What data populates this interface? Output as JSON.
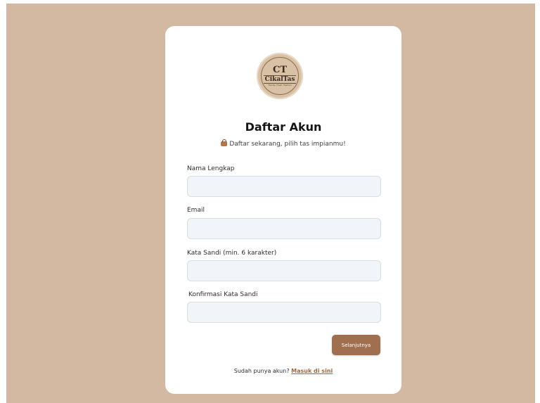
{
  "logo": {
    "monogram": "CT",
    "name": "CikalTas",
    "tagline": "Trendy, Fresh, Fashion"
  },
  "form": {
    "title": "Daftar Akun",
    "subtitle": "Daftar sekarang, pilih tas impianmu!",
    "subtitle_icon": "handbag-icon",
    "fields": [
      {
        "label": "Nama Lengkap",
        "value": "",
        "placeholder": ""
      },
      {
        "label": "Email",
        "value": "",
        "placeholder": ""
      },
      {
        "label": "Kata Sandi (min. 6 karakter)",
        "value": "",
        "placeholder": ""
      },
      {
        "label": "Konfirmasi Kata Sandi",
        "value": "",
        "placeholder": ""
      }
    ],
    "next_button": "Selanjutnya",
    "footer_text": "Sudah punya akun?",
    "footer_link": "Masuk di sini"
  },
  "colors": {
    "background": "#d3b9a2",
    "card": "#ffffff",
    "accent": "#9f6f4f",
    "link": "#a0673a",
    "input_bg": "#f1f4f9"
  }
}
